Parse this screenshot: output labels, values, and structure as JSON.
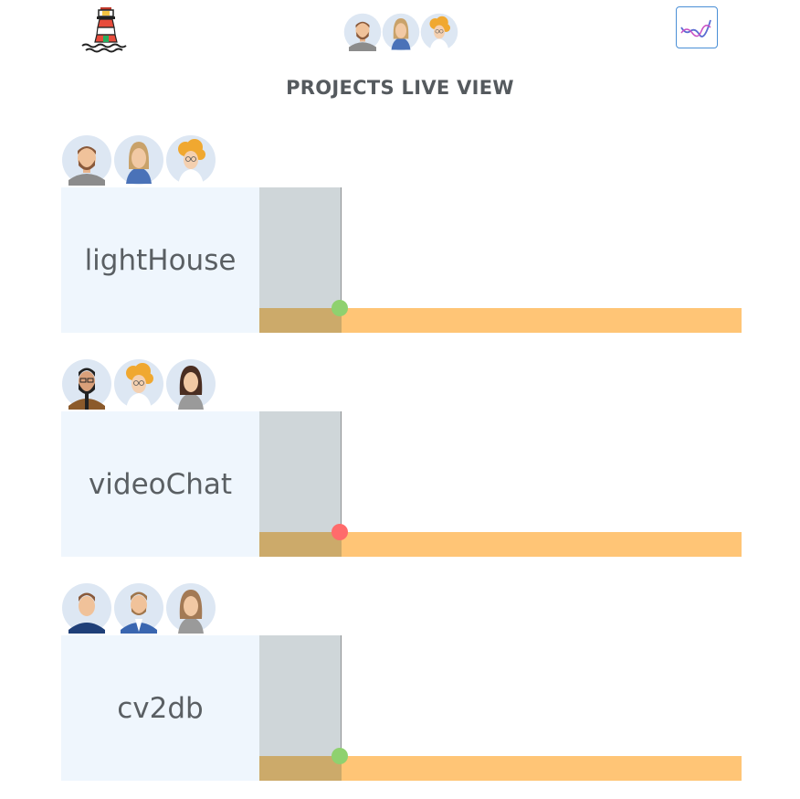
{
  "header": {
    "logo_icon": "lighthouse-icon",
    "chart_button_icon": "line-chart-icon",
    "team_avatars": [
      "avatar-bearded-man",
      "avatar-blonde-woman",
      "avatar-curly-woman"
    ]
  },
  "page": {
    "title": "PROJECTS LIVE VIEW"
  },
  "projects": [
    {
      "name": "lightHouse",
      "status": "ok",
      "status_color": "#8fd16f",
      "team": [
        "avatar-bearded-man",
        "avatar-blonde-woman",
        "avatar-curly-woman"
      ]
    },
    {
      "name": "videoChat",
      "status": "alert",
      "status_color": "#ff6b6b",
      "team": [
        "avatar-man-glasses-beard",
        "avatar-curly-woman",
        "avatar-brunette-woman"
      ]
    },
    {
      "name": "cv2db",
      "status": "ok",
      "status_color": "#8fd16f",
      "team": [
        "avatar-young-man",
        "avatar-man-blazer",
        "avatar-long-hair-woman"
      ]
    }
  ],
  "colors": {
    "name_box": "#eff6fd",
    "elapsed": "#cfd6d9",
    "progress_past": "#ccaa6a",
    "progress_future": "#ffc576",
    "accent": "#4a8fd6"
  }
}
